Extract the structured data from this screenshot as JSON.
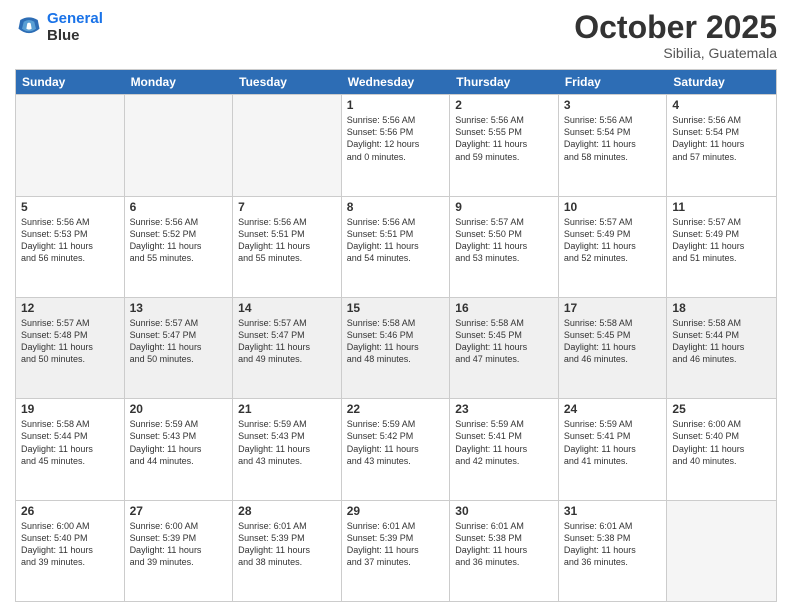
{
  "logo": {
    "line1": "General",
    "line2": "Blue"
  },
  "title": "October 2025",
  "location": "Sibilia, Guatemala",
  "header_days": [
    "Sunday",
    "Monday",
    "Tuesday",
    "Wednesday",
    "Thursday",
    "Friday",
    "Saturday"
  ],
  "rows": [
    [
      {
        "day": "",
        "info": "",
        "empty": true
      },
      {
        "day": "",
        "info": "",
        "empty": true
      },
      {
        "day": "",
        "info": "",
        "empty": true
      },
      {
        "day": "1",
        "info": "Sunrise: 5:56 AM\nSunset: 5:56 PM\nDaylight: 12 hours\nand 0 minutes."
      },
      {
        "day": "2",
        "info": "Sunrise: 5:56 AM\nSunset: 5:55 PM\nDaylight: 11 hours\nand 59 minutes."
      },
      {
        "day": "3",
        "info": "Sunrise: 5:56 AM\nSunset: 5:54 PM\nDaylight: 11 hours\nand 58 minutes."
      },
      {
        "day": "4",
        "info": "Sunrise: 5:56 AM\nSunset: 5:54 PM\nDaylight: 11 hours\nand 57 minutes."
      }
    ],
    [
      {
        "day": "5",
        "info": "Sunrise: 5:56 AM\nSunset: 5:53 PM\nDaylight: 11 hours\nand 56 minutes."
      },
      {
        "day": "6",
        "info": "Sunrise: 5:56 AM\nSunset: 5:52 PM\nDaylight: 11 hours\nand 55 minutes."
      },
      {
        "day": "7",
        "info": "Sunrise: 5:56 AM\nSunset: 5:51 PM\nDaylight: 11 hours\nand 55 minutes."
      },
      {
        "day": "8",
        "info": "Sunrise: 5:56 AM\nSunset: 5:51 PM\nDaylight: 11 hours\nand 54 minutes."
      },
      {
        "day": "9",
        "info": "Sunrise: 5:57 AM\nSunset: 5:50 PM\nDaylight: 11 hours\nand 53 minutes."
      },
      {
        "day": "10",
        "info": "Sunrise: 5:57 AM\nSunset: 5:49 PM\nDaylight: 11 hours\nand 52 minutes."
      },
      {
        "day": "11",
        "info": "Sunrise: 5:57 AM\nSunset: 5:49 PM\nDaylight: 11 hours\nand 51 minutes."
      }
    ],
    [
      {
        "day": "12",
        "info": "Sunrise: 5:57 AM\nSunset: 5:48 PM\nDaylight: 11 hours\nand 50 minutes.",
        "shaded": true
      },
      {
        "day": "13",
        "info": "Sunrise: 5:57 AM\nSunset: 5:47 PM\nDaylight: 11 hours\nand 50 minutes.",
        "shaded": true
      },
      {
        "day": "14",
        "info": "Sunrise: 5:57 AM\nSunset: 5:47 PM\nDaylight: 11 hours\nand 49 minutes.",
        "shaded": true
      },
      {
        "day": "15",
        "info": "Sunrise: 5:58 AM\nSunset: 5:46 PM\nDaylight: 11 hours\nand 48 minutes.",
        "shaded": true
      },
      {
        "day": "16",
        "info": "Sunrise: 5:58 AM\nSunset: 5:45 PM\nDaylight: 11 hours\nand 47 minutes.",
        "shaded": true
      },
      {
        "day": "17",
        "info": "Sunrise: 5:58 AM\nSunset: 5:45 PM\nDaylight: 11 hours\nand 46 minutes.",
        "shaded": true
      },
      {
        "day": "18",
        "info": "Sunrise: 5:58 AM\nSunset: 5:44 PM\nDaylight: 11 hours\nand 46 minutes.",
        "shaded": true
      }
    ],
    [
      {
        "day": "19",
        "info": "Sunrise: 5:58 AM\nSunset: 5:44 PM\nDaylight: 11 hours\nand 45 minutes."
      },
      {
        "day": "20",
        "info": "Sunrise: 5:59 AM\nSunset: 5:43 PM\nDaylight: 11 hours\nand 44 minutes."
      },
      {
        "day": "21",
        "info": "Sunrise: 5:59 AM\nSunset: 5:43 PM\nDaylight: 11 hours\nand 43 minutes."
      },
      {
        "day": "22",
        "info": "Sunrise: 5:59 AM\nSunset: 5:42 PM\nDaylight: 11 hours\nand 43 minutes."
      },
      {
        "day": "23",
        "info": "Sunrise: 5:59 AM\nSunset: 5:41 PM\nDaylight: 11 hours\nand 42 minutes."
      },
      {
        "day": "24",
        "info": "Sunrise: 5:59 AM\nSunset: 5:41 PM\nDaylight: 11 hours\nand 41 minutes."
      },
      {
        "day": "25",
        "info": "Sunrise: 6:00 AM\nSunset: 5:40 PM\nDaylight: 11 hours\nand 40 minutes."
      }
    ],
    [
      {
        "day": "26",
        "info": "Sunrise: 6:00 AM\nSunset: 5:40 PM\nDaylight: 11 hours\nand 39 minutes."
      },
      {
        "day": "27",
        "info": "Sunrise: 6:00 AM\nSunset: 5:39 PM\nDaylight: 11 hours\nand 39 minutes."
      },
      {
        "day": "28",
        "info": "Sunrise: 6:01 AM\nSunset: 5:39 PM\nDaylight: 11 hours\nand 38 minutes."
      },
      {
        "day": "29",
        "info": "Sunrise: 6:01 AM\nSunset: 5:39 PM\nDaylight: 11 hours\nand 37 minutes."
      },
      {
        "day": "30",
        "info": "Sunrise: 6:01 AM\nSunset: 5:38 PM\nDaylight: 11 hours\nand 36 minutes."
      },
      {
        "day": "31",
        "info": "Sunrise: 6:01 AM\nSunset: 5:38 PM\nDaylight: 11 hours\nand 36 minutes."
      },
      {
        "day": "",
        "info": "",
        "empty": true
      }
    ]
  ]
}
